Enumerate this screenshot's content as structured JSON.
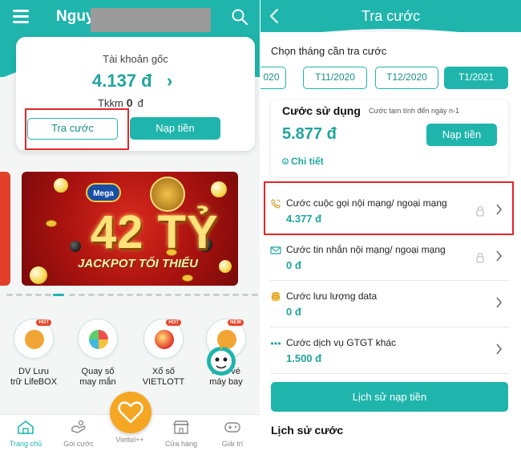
{
  "left": {
    "header": {
      "title": "Nguy",
      "menu_icon": "hamburger-icon",
      "search_icon": "search-icon",
      "bg_color": "#1fb5ad"
    },
    "account": {
      "label": "Tài khoản gốc",
      "balance": "4.137 đ",
      "chevron": "›",
      "tkkm_label": "Tkkm",
      "tkkm_value": "0",
      "tkkm_unit": "đ",
      "tra_cuoc_button": "Tra cước",
      "nap_tien_button": "Nạp tiền"
    },
    "banner": {
      "logo_text": "Mega",
      "headline": "42 TỶ",
      "subline": "JACKPOT TỐI THIỂU"
    },
    "services": [
      {
        "label": "DV Lưu\ntrữ LifeBOX",
        "badge": "HOT",
        "icon": "lifebox-icon"
      },
      {
        "label": "Quay số\nmay mắn",
        "badge": "",
        "icon": "lucky-wheel-icon"
      },
      {
        "label": "Xổ số\nVIETLOTT",
        "badge": "HOT",
        "icon": "vietlott-icon"
      },
      {
        "label": "Mua vé\nmáy bay",
        "badge": "NEW",
        "icon": "airplane-icon"
      }
    ],
    "tabs": [
      {
        "label": "Trang chủ",
        "icon": "home-icon",
        "active": true
      },
      {
        "label": "Gói cước",
        "icon": "package-icon",
        "active": false
      },
      {
        "label": "Viettel++",
        "icon": "heart-icon",
        "active": false
      },
      {
        "label": "Cửa hàng",
        "icon": "store-icon",
        "active": false
      },
      {
        "label": "Giải trí",
        "icon": "gamepad-icon",
        "active": false
      }
    ]
  },
  "right": {
    "header": {
      "title": "Tra cước",
      "back_icon": "back-arrow-icon"
    },
    "choose_label": "Chọn tháng cần tra cước",
    "months": [
      {
        "label": "020",
        "active": false
      },
      {
        "label": "T11/2020",
        "active": false
      },
      {
        "label": "T12/2020",
        "active": false
      },
      {
        "label": "T1/2021",
        "active": true
      }
    ],
    "usage": {
      "title": "Cước sử dụng",
      "note": "Cước tạm tính đến ngày n-1",
      "amount": "5.877 đ",
      "button": "Nạp tiền",
      "detail": "Chi tiết",
      "detail_icon": "info-icon"
    },
    "charges": [
      {
        "label": "Cước cuộc gọi nội mạng/ ngoại mạng",
        "value": "4.377 đ",
        "icon": "phone-call-icon",
        "locked": true
      },
      {
        "label": "Cước tin nhắn nội mạng/ ngoại mạng",
        "value": "0 đ",
        "icon": "message-icon",
        "locked": true
      },
      {
        "label": "Cước lưu lượng data",
        "value": "0 đ",
        "icon": "database-icon",
        "locked": false
      },
      {
        "label": "Cước dịch vụ GTGT khác",
        "value": "1.500 đ",
        "icon": "more-dots-icon",
        "locked": false
      }
    ],
    "history_button": "Lịch sử nạp tiền",
    "history_title": "Lịch sử cước"
  },
  "colors": {
    "primary": "#1fb5ad",
    "highlight_red": "#e0262b",
    "fab_orange": "#f5a623"
  }
}
